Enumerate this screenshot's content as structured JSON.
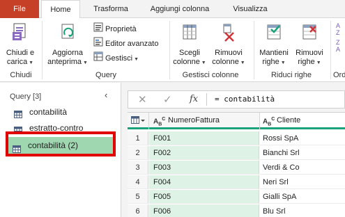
{
  "tabs": {
    "file": "File",
    "home": "Home",
    "trasforma": "Trasforma",
    "aggiungi_colonna": "Aggiungi colonna",
    "visualizza": "Visualizza"
  },
  "ribbon": {
    "chiudi_carica_line1": "Chiudi e",
    "chiudi_carica_line2": "carica",
    "group_chiudi": "Chiudi",
    "aggiorna_line1": "Aggiorna",
    "aggiorna_line2": "anteprima",
    "proprieta": "Proprietà",
    "editor_avanzato": "Editor avanzato",
    "gestisci": "Gestisci",
    "group_query": "Query",
    "scegli_line1": "Scegli",
    "scegli_line2": "colonne",
    "rimuovi_col_line1": "Rimuovi",
    "rimuovi_col_line2": "colonne",
    "group_gestisci_colonne": "Gestisci colonne",
    "mantieni_line1": "Mantieni",
    "mantieni_line2": "righe",
    "rimuovi_righe_line1": "Rimuovi",
    "rimuovi_righe_line2": "righe",
    "group_riduci_righe": "Riduci righe",
    "group_ord_partial": "Ord"
  },
  "query_pane": {
    "header": "Query [3]",
    "items": [
      {
        "label": "contabilità"
      },
      {
        "label": "estratto-contro"
      },
      {
        "label": "contabilità (2)"
      }
    ]
  },
  "formula_bar": {
    "formula": "= contabilità"
  },
  "grid": {
    "columns": [
      {
        "type_label": "A",
        "name": "NumeroFattura"
      },
      {
        "type_label": "A",
        "name": "Cliente"
      }
    ],
    "rows": [
      {
        "n": "1",
        "numero": "F001",
        "cliente": "Rossi SpA"
      },
      {
        "n": "2",
        "numero": "F002",
        "cliente": "Bianchi Srl"
      },
      {
        "n": "3",
        "numero": "F003",
        "cliente": "Verdi & Co"
      },
      {
        "n": "4",
        "numero": "F004",
        "cliente": "Neri Srl"
      },
      {
        "n": "5",
        "numero": "F005",
        "cliente": "Gialli SpA"
      },
      {
        "n": "6",
        "numero": "F006",
        "cliente": "Blu Srl"
      }
    ]
  },
  "colors": {
    "file_tab": "#c63f27",
    "accent_green": "#1aa37a",
    "selected_query": "#9fd7b0",
    "highlight_box": "#e10000"
  }
}
